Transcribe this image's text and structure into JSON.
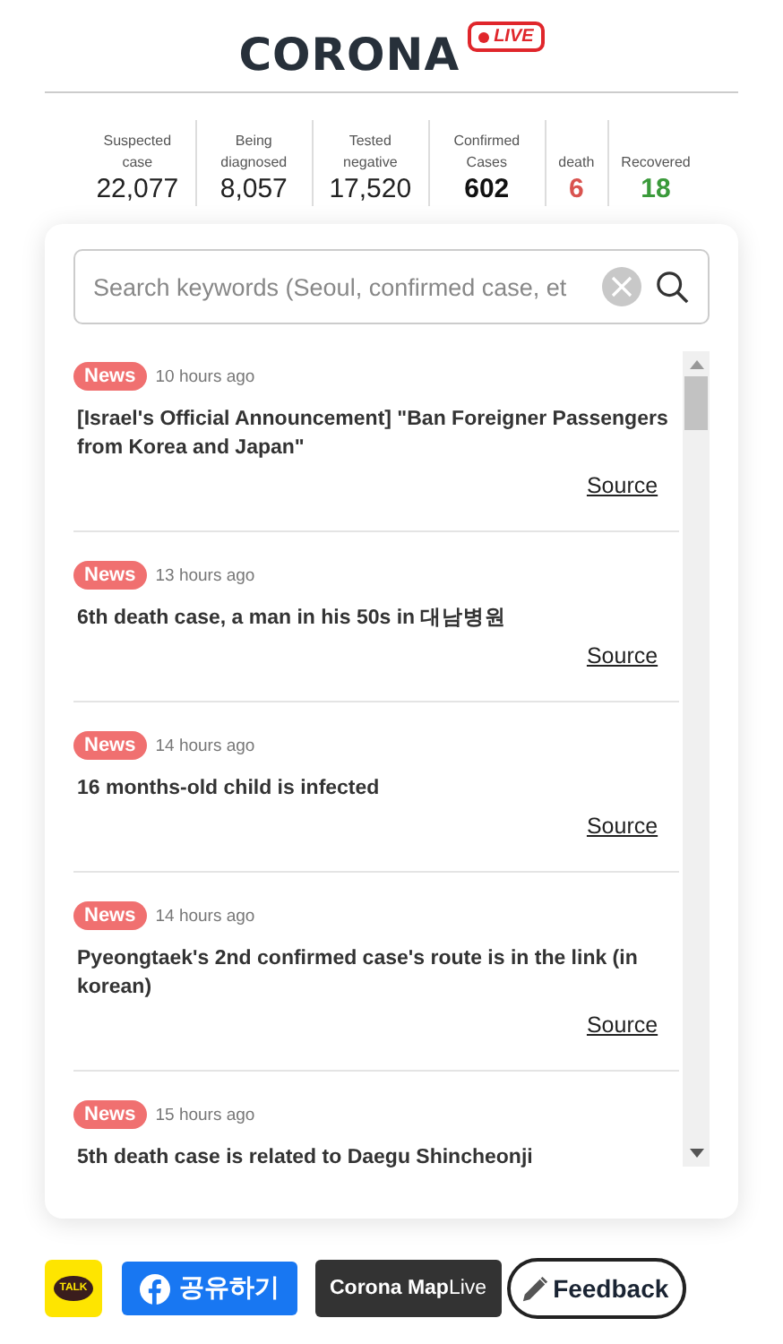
{
  "header": {
    "title": "CORONA",
    "live_badge": "LIVE"
  },
  "stats": [
    {
      "label": "Suspected case",
      "value": "22,077",
      "kind": "plain"
    },
    {
      "label": "Being diagnosed",
      "value": "8,057",
      "kind": "plain"
    },
    {
      "label": "Tested negative",
      "value": "17,520",
      "kind": "plain"
    },
    {
      "label": "Confirmed Cases",
      "value": "602",
      "kind": "confirmed"
    },
    {
      "label": "death",
      "value": "6",
      "kind": "death"
    },
    {
      "label": "Recovered",
      "value": "18",
      "kind": "recovered"
    }
  ],
  "search": {
    "placeholder": "Search keywords (Seoul, confirmed case, et"
  },
  "news": [
    {
      "tag": "News",
      "time": "10 hours ago",
      "headline": "[Israel's Official Announcement] \"Ban Foreigner Passengers from Korea and Japan\"",
      "source": "Source"
    },
    {
      "tag": "News",
      "time": "13 hours ago",
      "headline": "6th death case, a man in his 50s in 대남병원",
      "source": "Source"
    },
    {
      "tag": "News",
      "time": "14 hours ago",
      "headline": "16 months-old child is infected",
      "source": "Source"
    },
    {
      "tag": "News",
      "time": "14 hours ago",
      "headline": "Pyeongtaek's 2nd confirmed case's route is in the link (in korean)",
      "source": "Source"
    },
    {
      "tag": "News",
      "time": "15 hours ago",
      "headline": "5th death case is related to Daegu Shincheonji"
    }
  ],
  "footer": {
    "kakao": "TALK",
    "share": "공유하기",
    "map": "**Corona Map**Live",
    "feedback": "Feedback"
  }
}
